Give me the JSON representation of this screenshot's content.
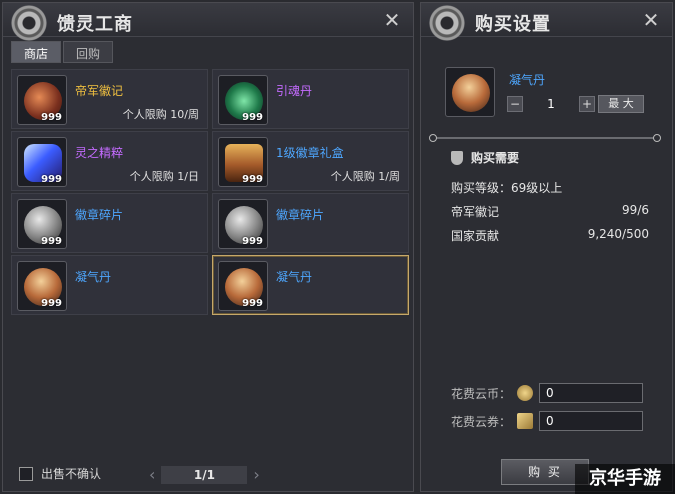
{
  "left_panel": {
    "title": "馈灵工商",
    "close_icon": "close-icon",
    "tabs": [
      {
        "label": "商店",
        "active": true
      },
      {
        "label": "回购",
        "active": false
      }
    ],
    "items": [
      {
        "name": "帝军徽记",
        "qty": "999",
        "limit": "个人限购 10/周",
        "color": "#f0c040",
        "icon": "token-icon"
      },
      {
        "name": "引魂丹",
        "qty": "999",
        "limit": "",
        "color": "#c46bff",
        "icon": "orb-icon"
      },
      {
        "name": "灵之精粹",
        "qty": "999",
        "limit": "个人限购 1/日",
        "color": "#c46bff",
        "icon": "crystal-icon"
      },
      {
        "name": "1级徽章礼盒",
        "qty": "999",
        "limit": "个人限购 1/周",
        "color": "#4ea7ff",
        "icon": "chest-icon"
      },
      {
        "name": "徽章碎片",
        "qty": "999",
        "limit": "",
        "color": "#4ea7ff",
        "icon": "fragment-icon"
      },
      {
        "name": "徽章碎片",
        "qty": "999",
        "limit": "",
        "color": "#4ea7ff",
        "icon": "fragment-icon"
      },
      {
        "name": "凝气丹",
        "qty": "999",
        "limit": "",
        "color": "#4ea7ff",
        "icon": "pill-icon"
      },
      {
        "name": "凝气丹",
        "qty": "999",
        "limit": "",
        "color": "#4ea7ff",
        "icon": "pill-icon",
        "selected": true
      }
    ],
    "no_confirm_label": "出售不确认",
    "pager": {
      "text": "1/1"
    }
  },
  "right_panel": {
    "title": "购买设置",
    "selected_item": {
      "name": "凝气丹",
      "quantity": "1",
      "max_label": "最 大"
    },
    "requirements_title": "购买需要",
    "requirements": [
      {
        "label": "购买等级：69级以上",
        "value": ""
      },
      {
        "label": "帝军徽记",
        "value": "99/6"
      },
      {
        "label": "国家贡献",
        "value": "9,240/500"
      }
    ],
    "fees": [
      {
        "label": "花费云币：",
        "value": "0"
      },
      {
        "label": "花费云券：",
        "value": "0"
      }
    ],
    "buy_label": "购 买"
  },
  "watermark": "京华手游",
  "colors": {
    "gold": "#f0c040",
    "purple": "#c46bff",
    "blue": "#4ea7ff",
    "selected_border": "#c6a86a"
  }
}
